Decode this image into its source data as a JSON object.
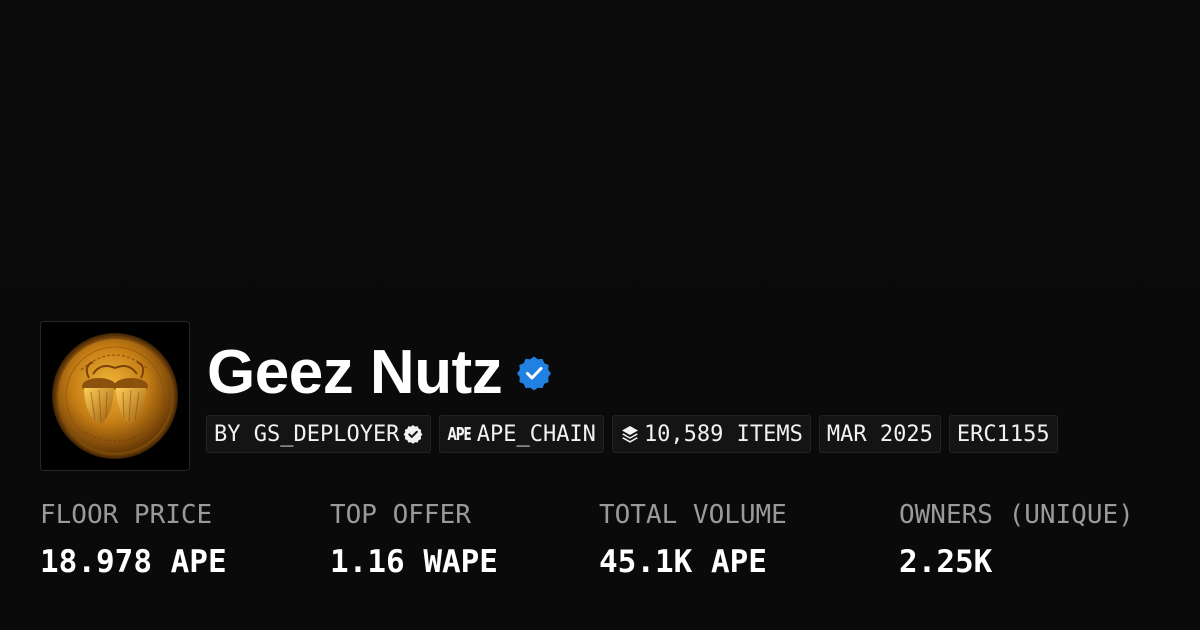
{
  "collection": {
    "name": "Geez Nutz",
    "avatar_icon": "acorn-coin-icon",
    "verified_icon": "verified-badge-icon"
  },
  "tags": {
    "creator": "BY GS_DEPLOYER",
    "chain_logo": "APE",
    "chain": "APE_CHAIN",
    "items": "10,589 ITEMS",
    "date": "MAR 2025",
    "standard": "ERC1155"
  },
  "stats": [
    {
      "label": "FLOOR PRICE",
      "value": "18.978 APE"
    },
    {
      "label": "TOP OFFER",
      "value": "1.16 WAPE"
    },
    {
      "label": "TOTAL VOLUME",
      "value": "45.1K APE"
    },
    {
      "label": "OWNERS (UNIQUE)",
      "value": "2.25K"
    }
  ],
  "colors": {
    "background": "#0a0a0a",
    "verified_blue": "#2081e2",
    "label_gray": "#9a9a9a"
  }
}
